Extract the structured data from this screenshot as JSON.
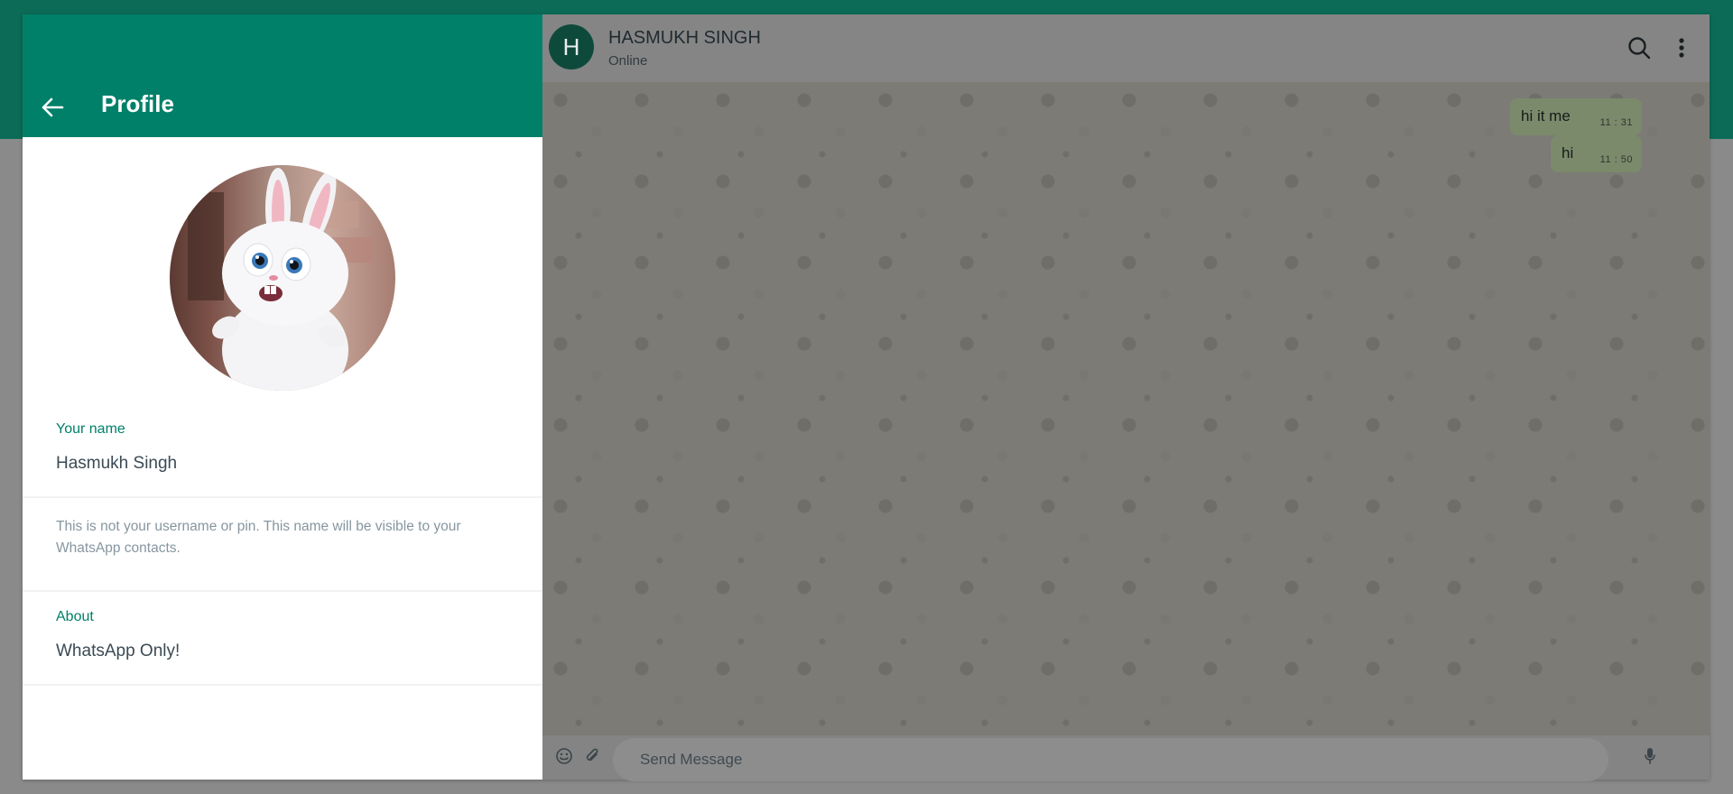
{
  "profile_panel": {
    "title": "Profile",
    "name_label": "Your name",
    "name_value": "Hasmukh Singh",
    "name_hint": "This is not your username or pin. This name will be visible to your WhatsApp contacts.",
    "about_label": "About",
    "about_value": "WhatsApp Only!"
  },
  "chat_header": {
    "avatar_initial": "H",
    "contact_name": "HASMUKH SINGH",
    "status": "Online"
  },
  "messages": [
    {
      "text": "hi it me",
      "time": "11 : 31"
    },
    {
      "text": "hi",
      "time": "11 : 50"
    }
  ],
  "composer": {
    "placeholder": "Send Message"
  },
  "icons": {
    "back": "arrow-left-icon",
    "search": "search-icon",
    "menu": "more-vertical-icon",
    "emoji": "emoji-icon",
    "attach": "paperclip-icon",
    "mic": "microphone-icon"
  },
  "colors": {
    "header_green": "#008069",
    "accent_green": "#008069",
    "top_band": "#0b6b57",
    "outgoing_bubble": "#d9fdd3"
  }
}
